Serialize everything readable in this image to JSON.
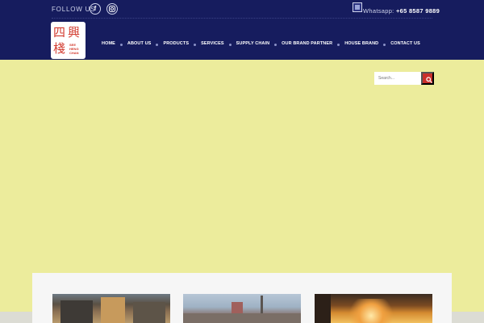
{
  "topbar": {
    "follow_label": "FOLLOW US",
    "social": [
      {
        "icon": "facebook-icon",
        "glyph": "f"
      },
      {
        "icon": "instagram-icon"
      }
    ],
    "whatsapp_label": "Whatsapp:",
    "whatsapp_number": "+65 8587 9889"
  },
  "logo": {
    "chars": [
      "四",
      "興",
      "棧"
    ],
    "brand_text": "SEE HENG CHAN"
  },
  "nav": {
    "items": [
      "HOME",
      "ABOUT US",
      "PRODUCTS",
      "SERVICES",
      "SUPPLY CHAIN",
      "OUR BRAND PARTNER",
      "HOUSE BRAND",
      "CONTACT US"
    ]
  },
  "search": {
    "placeholder": "Search..."
  },
  "colors": {
    "header_bg": "#161c5e",
    "hero_bg": "#ecec9c",
    "search_button": "#c9302c",
    "logo_red": "#d23a2e"
  }
}
